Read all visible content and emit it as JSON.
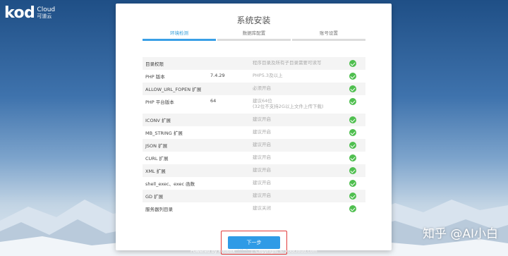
{
  "brand": {
    "mark": "kod",
    "cloud": "Cloud",
    "cn": "可道云"
  },
  "card": {
    "title": "系统安装",
    "steps": [
      {
        "label": "环境检测",
        "active": true
      },
      {
        "label": "数据库配置",
        "active": false
      },
      {
        "label": "账号设置",
        "active": false
      }
    ]
  },
  "checks": [
    {
      "name": "目录权限",
      "value": "",
      "note": "程序目录及所有子目录需要可读写",
      "ok": true
    },
    {
      "name": "PHP 版本",
      "value": "7.4.29",
      "note": "PHP5.3及以上",
      "ok": true
    },
    {
      "name": "ALLOW_URL_FOPEN 扩展",
      "value": "",
      "note": "必须开启",
      "ok": true
    },
    {
      "name": "PHP 平台版本",
      "value": "64",
      "note": "建议64位",
      "note2": "(32位不支持2G以上文件上传下载)",
      "ok": true
    },
    {
      "name": "ICONV 扩展",
      "value": "",
      "note": "建议开启",
      "ok": true
    },
    {
      "name": "MB_STRING 扩展",
      "value": "",
      "note": "建议开启",
      "ok": true
    },
    {
      "name": "JSON 扩展",
      "value": "",
      "note": "建议开启",
      "ok": true
    },
    {
      "name": "CURL 扩展",
      "value": "",
      "note": "建议开启",
      "ok": true
    },
    {
      "name": "XML 扩展",
      "value": "",
      "note": "建议开启",
      "ok": true
    },
    {
      "name": "shell_exec、exec 函数",
      "value": "",
      "note": "建议开启",
      "ok": true
    },
    {
      "name": "GD 扩展",
      "value": "",
      "note": "建议开启",
      "ok": true
    },
    {
      "name": "服务器列目录",
      "value": "",
      "note": "建议关闭",
      "ok": true
    }
  ],
  "actions": {
    "next_label": "下一步"
  },
  "footer": {
    "powered": "Powered by kodbox",
    "version": "V1.3",
    "sep": "|",
    "copyright": "Copyright © kodcloud.com"
  },
  "watermark": "知乎 @AI小白",
  "colors": {
    "accent": "#3aa0e6",
    "ok": "#4fbf4f",
    "highlight": "#e23b3b"
  }
}
